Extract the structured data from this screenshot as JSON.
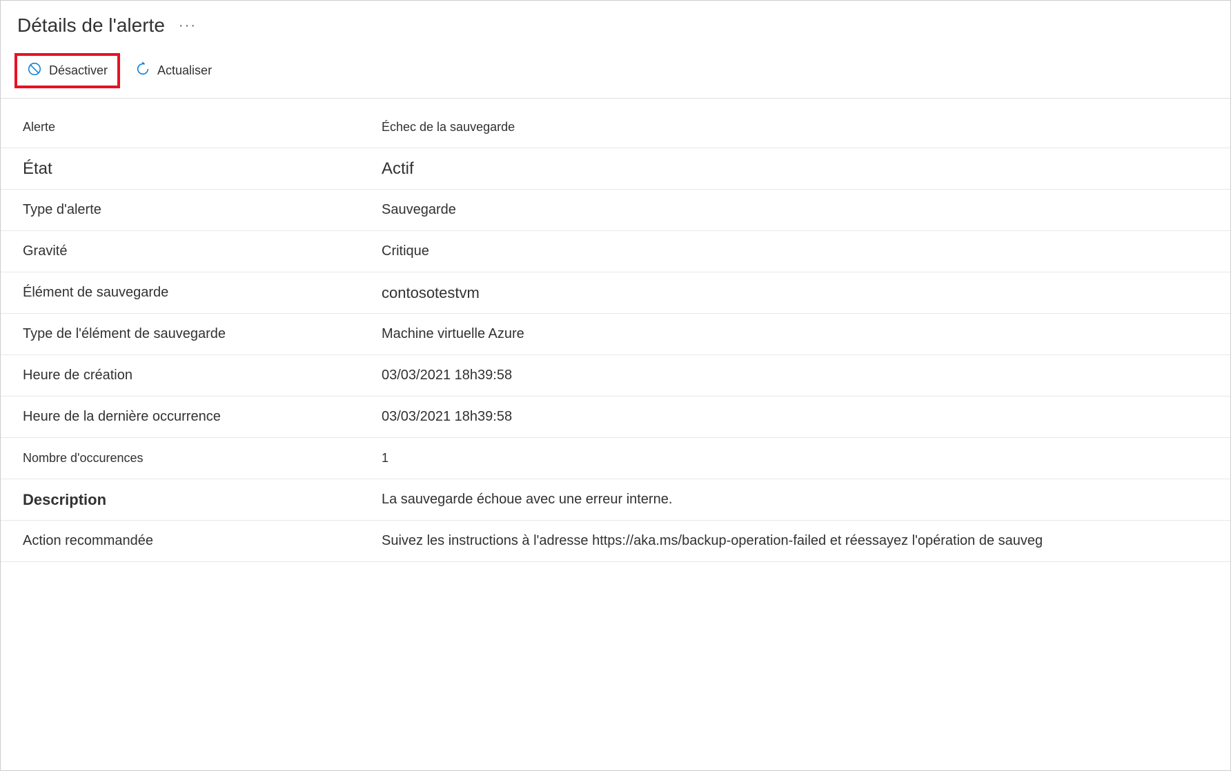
{
  "header": {
    "title": "Détails de l'alerte"
  },
  "toolbar": {
    "deactivate_label": "Désactiver",
    "refresh_label": "Actualiser"
  },
  "details": {
    "rows": [
      {
        "label": "Alerte",
        "value": "Échec de la sauvegarde",
        "style": "small"
      },
      {
        "label": "État",
        "value": "Actif",
        "style": "emphasis"
      },
      {
        "label": "Type d'alerte",
        "value": "Sauvegarde",
        "style": ""
      },
      {
        "label": "Gravité",
        "value": "Critique",
        "style": ""
      },
      {
        "label": "Élément de sauvegarde",
        "value": "contosotestvm",
        "style": "element"
      },
      {
        "label": "Type de l'élément de sauvegarde",
        "value": "Machine virtuelle Azure",
        "style": ""
      },
      {
        "label": "Heure de création",
        "value": "03/03/2021 18h39:58",
        "style": ""
      },
      {
        "label": "Heure de la dernière occurrence",
        "value": "03/03/2021 18h39:58",
        "style": ""
      },
      {
        "label": "Nombre d'occurences",
        "value": "1",
        "style": "small"
      },
      {
        "label": "Description",
        "value": "La sauvegarde échoue avec une erreur interne.",
        "style": "bold-label"
      },
      {
        "label": "Action recommandée",
        "value": "Suivez les instructions à l'adresse https://aka.ms/backup-operation-failed et réessayez l'opération de sauveg",
        "style": ""
      }
    ]
  }
}
